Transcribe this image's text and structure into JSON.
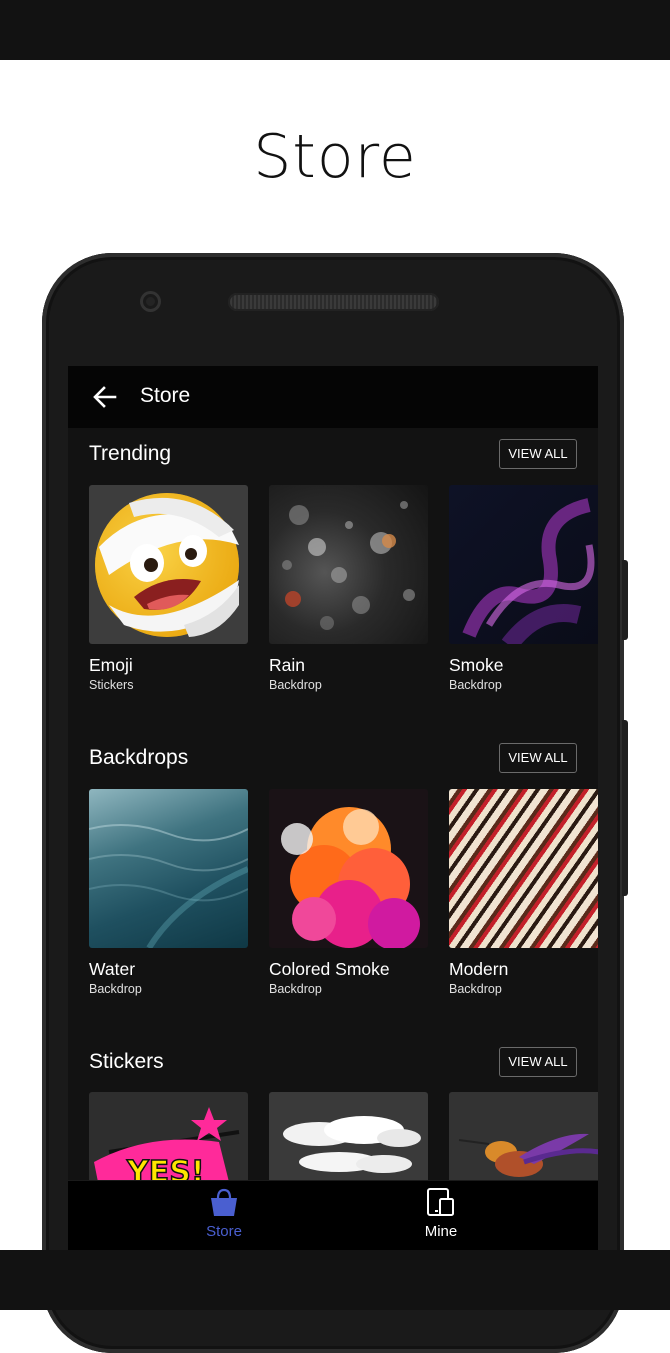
{
  "promo": {
    "title": "Store"
  },
  "app_bar": {
    "back_icon": "arrow-left-icon",
    "title": "Store"
  },
  "sections": [
    {
      "title": "Trending",
      "view_all_label": "VIEW ALL",
      "items": [
        {
          "name": "Emoji",
          "category": "Stickers",
          "thumb": "emoji-bandaged-face"
        },
        {
          "name": "Rain",
          "category": "Backdrop",
          "thumb": "rain-on-glass"
        },
        {
          "name": "Smoke",
          "category": "Backdrop",
          "thumb": "purple-smoke"
        }
      ]
    },
    {
      "title": "Backdrops",
      "view_all_label": "VIEW ALL",
      "items": [
        {
          "name": "Water",
          "category": "Backdrop",
          "thumb": "ocean-water"
        },
        {
          "name": "Colored Smoke",
          "category": "Backdrop",
          "thumb": "orange-pink-smoke"
        },
        {
          "name": "Modern",
          "category": "Backdrop",
          "thumb": "abstract-stripes"
        }
      ]
    },
    {
      "title": "Stickers",
      "view_all_label": "VIEW ALL",
      "items": [
        {
          "thumb": "yes-comic-sticker"
        },
        {
          "thumb": "clouds-sticker"
        },
        {
          "thumb": "hummingbird-sticker"
        }
      ]
    }
  ],
  "bottom_nav": {
    "items": [
      {
        "label": "Store",
        "icon": "shopping-bag-icon",
        "active": true
      },
      {
        "label": "Mine",
        "icon": "devices-icon",
        "active": false
      }
    ]
  },
  "colors": {
    "accent": "#4a5fd0",
    "background": "#121212",
    "app_bar": "#050505"
  }
}
